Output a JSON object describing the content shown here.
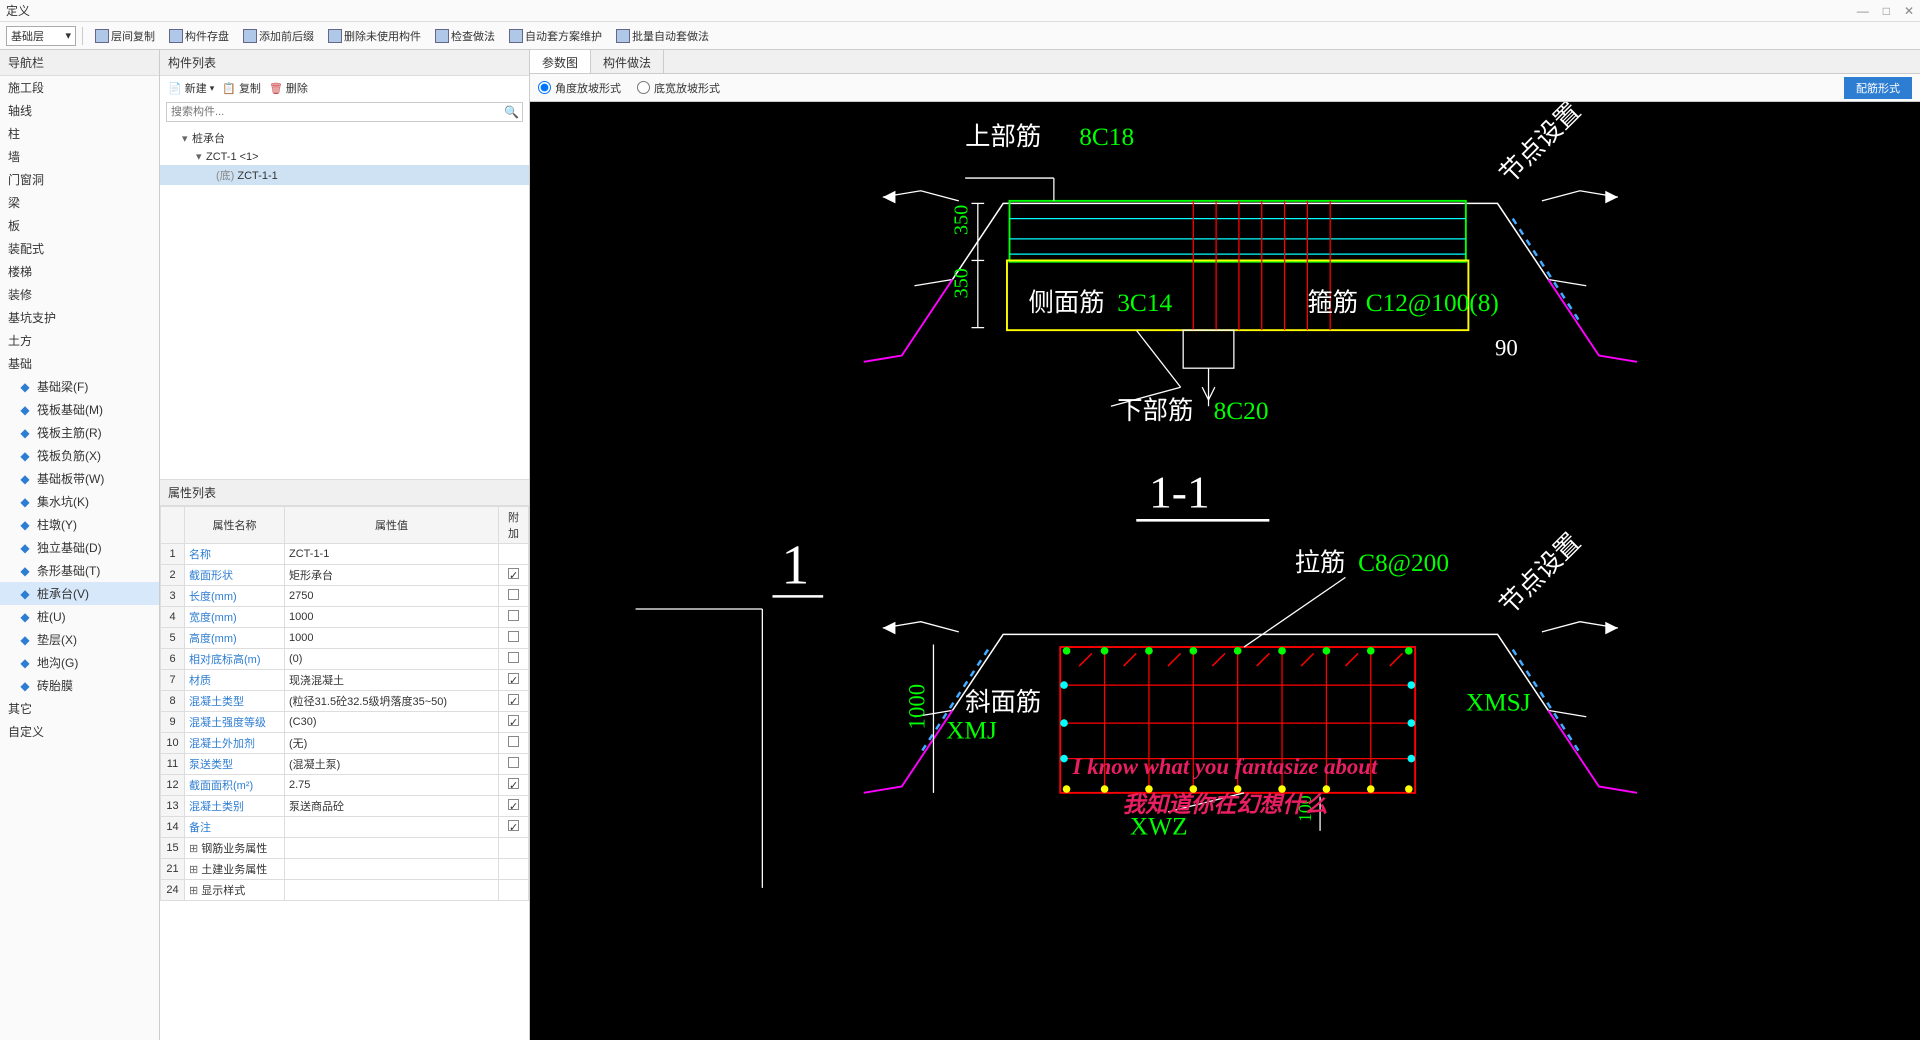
{
  "title": "定义",
  "floor_select": "基础层",
  "toolbar": [
    {
      "label": "层间复制",
      "icon": "copy-layer"
    },
    {
      "label": "构件存盘",
      "icon": "save"
    },
    {
      "label": "添加前后缀",
      "icon": "suffix"
    },
    {
      "label": "删除未使用构件",
      "icon": "delete-unused"
    },
    {
      "label": "检查做法",
      "icon": "check"
    },
    {
      "label": "自动套方案维护",
      "icon": "auto-plan"
    },
    {
      "label": "批量自动套做法",
      "icon": "batch"
    }
  ],
  "nav": {
    "title": "导航栏",
    "items": [
      "施工段",
      "轴线",
      "柱",
      "墙",
      "门窗洞",
      "梁",
      "板",
      "装配式",
      "楼梯",
      "装修",
      "基坑支护",
      "土方",
      "基础"
    ],
    "foundation_items": [
      {
        "label": "基础梁(F)",
        "icon": "beam"
      },
      {
        "label": "筏板基础(M)",
        "icon": "raft"
      },
      {
        "label": "筏板主筋(R)",
        "icon": "rebar-main"
      },
      {
        "label": "筏板负筋(X)",
        "icon": "rebar-neg"
      },
      {
        "label": "基础板带(W)",
        "icon": "strip"
      },
      {
        "label": "集水坑(K)",
        "icon": "sump"
      },
      {
        "label": "柱墩(Y)",
        "icon": "pier"
      },
      {
        "label": "独立基础(D)",
        "icon": "isolated"
      },
      {
        "label": "条形基础(T)",
        "icon": "strip-found"
      },
      {
        "label": "桩承台(V)",
        "icon": "pile-cap",
        "selected": true
      },
      {
        "label": "桩(U)",
        "icon": "pile"
      },
      {
        "label": "垫层(X)",
        "icon": "cushion"
      },
      {
        "label": "地沟(G)",
        "icon": "trench"
      },
      {
        "label": "砖胎膜",
        "icon": "brick"
      }
    ],
    "tail_items": [
      "其它",
      "自定义"
    ]
  },
  "mid": {
    "header": "构件列表",
    "actions": {
      "new": "新建",
      "copy": "复制",
      "delete": "删除"
    },
    "search_placeholder": "搜索构件...",
    "tree": {
      "root": "桩承台",
      "child1": "ZCT-1 <1>",
      "child2_prefix": "(底)",
      "child2_label": "ZCT-1-1"
    }
  },
  "props": {
    "header": "属性列表",
    "cols": {
      "name": "属性名称",
      "value": "属性值",
      "add": "附加"
    },
    "rows": [
      {
        "n": "1",
        "name": "名称",
        "value": "ZCT-1-1",
        "chk": false,
        "blue": true
      },
      {
        "n": "2",
        "name": "截面形状",
        "value": "矩形承台",
        "chk": true,
        "blue": true
      },
      {
        "n": "3",
        "name": "长度(mm)",
        "value": "2750",
        "chk": false,
        "blue": true
      },
      {
        "n": "4",
        "name": "宽度(mm)",
        "value": "1000",
        "chk": false,
        "blue": true
      },
      {
        "n": "5",
        "name": "高度(mm)",
        "value": "1000",
        "chk": false,
        "blue": true
      },
      {
        "n": "6",
        "name": "相对底标高(m)",
        "value": "(0)",
        "chk": false,
        "blue": true
      },
      {
        "n": "7",
        "name": "材质",
        "value": "现浇混凝土",
        "chk": true,
        "blue": true
      },
      {
        "n": "8",
        "name": "混凝土类型",
        "value": "(粒径31.5砼32.5级坍落度35~50)",
        "chk": true,
        "blue": true
      },
      {
        "n": "9",
        "name": "混凝土强度等级",
        "value": "(C30)",
        "chk": true,
        "blue": true
      },
      {
        "n": "10",
        "name": "混凝土外加剂",
        "value": "(无)",
        "chk": false,
        "blue": true
      },
      {
        "n": "11",
        "name": "泵送类型",
        "value": "(混凝土泵)",
        "chk": false,
        "blue": true
      },
      {
        "n": "12",
        "name": "截面面积(m²)",
        "value": "2.75",
        "chk": true,
        "blue": true
      },
      {
        "n": "13",
        "name": "混凝土类别",
        "value": "泵送商品砼",
        "chk": true,
        "blue": true
      },
      {
        "n": "14",
        "name": "备注",
        "value": "",
        "chk": true,
        "blue": true
      },
      {
        "n": "15",
        "name": "钢筋业务属性",
        "value": "",
        "chk": false,
        "blue": false,
        "expand": true
      },
      {
        "n": "21",
        "name": "土建业务属性",
        "value": "",
        "chk": false,
        "blue": false,
        "expand": true
      },
      {
        "n": "24",
        "name": "显示样式",
        "value": "",
        "chk": false,
        "blue": false,
        "expand": true
      }
    ]
  },
  "right": {
    "tabs": [
      {
        "label": "参数图",
        "active": true
      },
      {
        "label": "构件做法",
        "active": false
      }
    ],
    "opt1": "角度放坡形式",
    "opt2": "底宽放坡形式",
    "btn": "配筋形式"
  },
  "canvas": {
    "top_label": "上部筋",
    "top_val": "8C18",
    "side_label": "侧面筋",
    "side_val": "3C14",
    "stirrup_label": "箍筋",
    "stirrup_val": "C12@100(8)",
    "bottom_label": "下部筋",
    "bottom_val": "8C20",
    "dim350a": "350",
    "dim350b": "350",
    "dim90": "90",
    "section": "1-1",
    "node1": "节点设置",
    "node2": "节点设置",
    "tie_label": "拉筋",
    "tie_val": "C8@200",
    "oblique_label": "斜面筋",
    "xmj": "XMJ",
    "xmsj": "XMSJ",
    "xwz": "XWZ",
    "dim1000": "1000",
    "dim100": "100",
    "big1": "1",
    "sub_en": "I know what you fantasize about",
    "sub_cn": "我知道你在幻想什么"
  }
}
